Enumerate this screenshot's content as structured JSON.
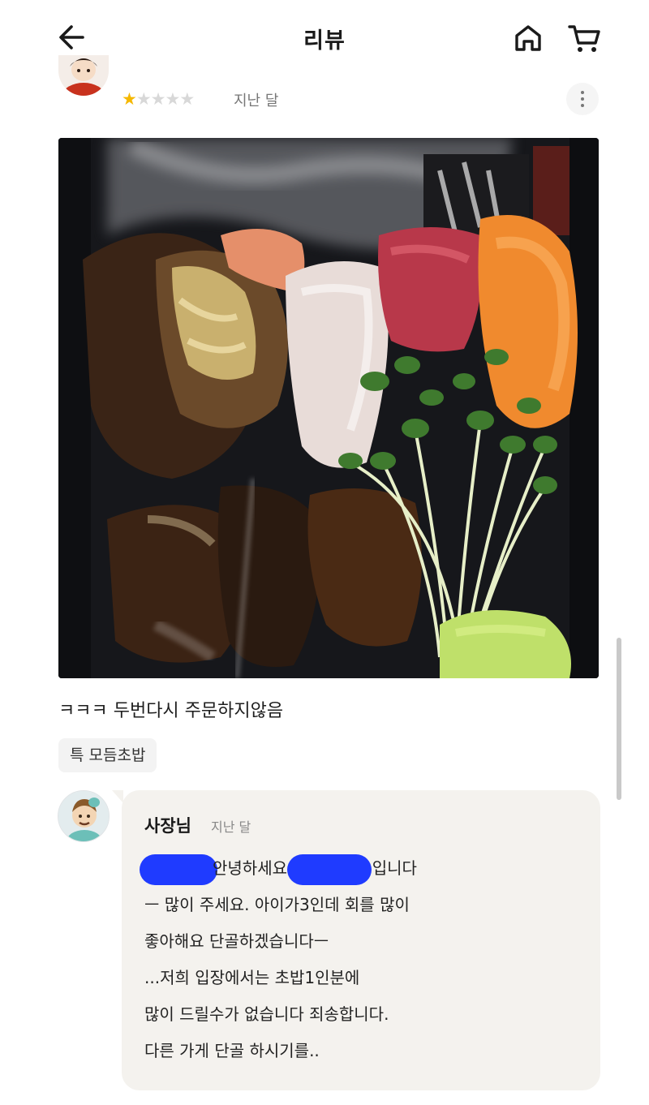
{
  "header": {
    "title": "리뷰",
    "back_icon": "arrow-left-icon",
    "home_icon": "home-icon",
    "cart_icon": "cart-icon"
  },
  "review": {
    "rating": 1,
    "rating_max": 5,
    "date": "지난 달",
    "text": "ㅋㅋㅋ  두번다시 주문하지않음",
    "menu_item": "특 모듬초밥"
  },
  "owner_reply": {
    "name": "사장님",
    "date": "지난 달",
    "line1_part1": "안녕하세요",
    "line1_part2": "입니다",
    "line2": "ㅡ 많이 주세요. 아이가3인데 회를 많이",
    "line3": "좋아해요 단골하겠습니다ㅡ",
    "line4": "...저희 입장에서는 초밥1인분에",
    "line5": "많이 드릴수가 없습니다 죄송합니다.",
    "line6": "다른 가게 단골 하시기를.."
  },
  "colors": {
    "star": "#f5b800",
    "redaction": "#1f3bff",
    "bubble_bg": "#f4f2ee"
  }
}
